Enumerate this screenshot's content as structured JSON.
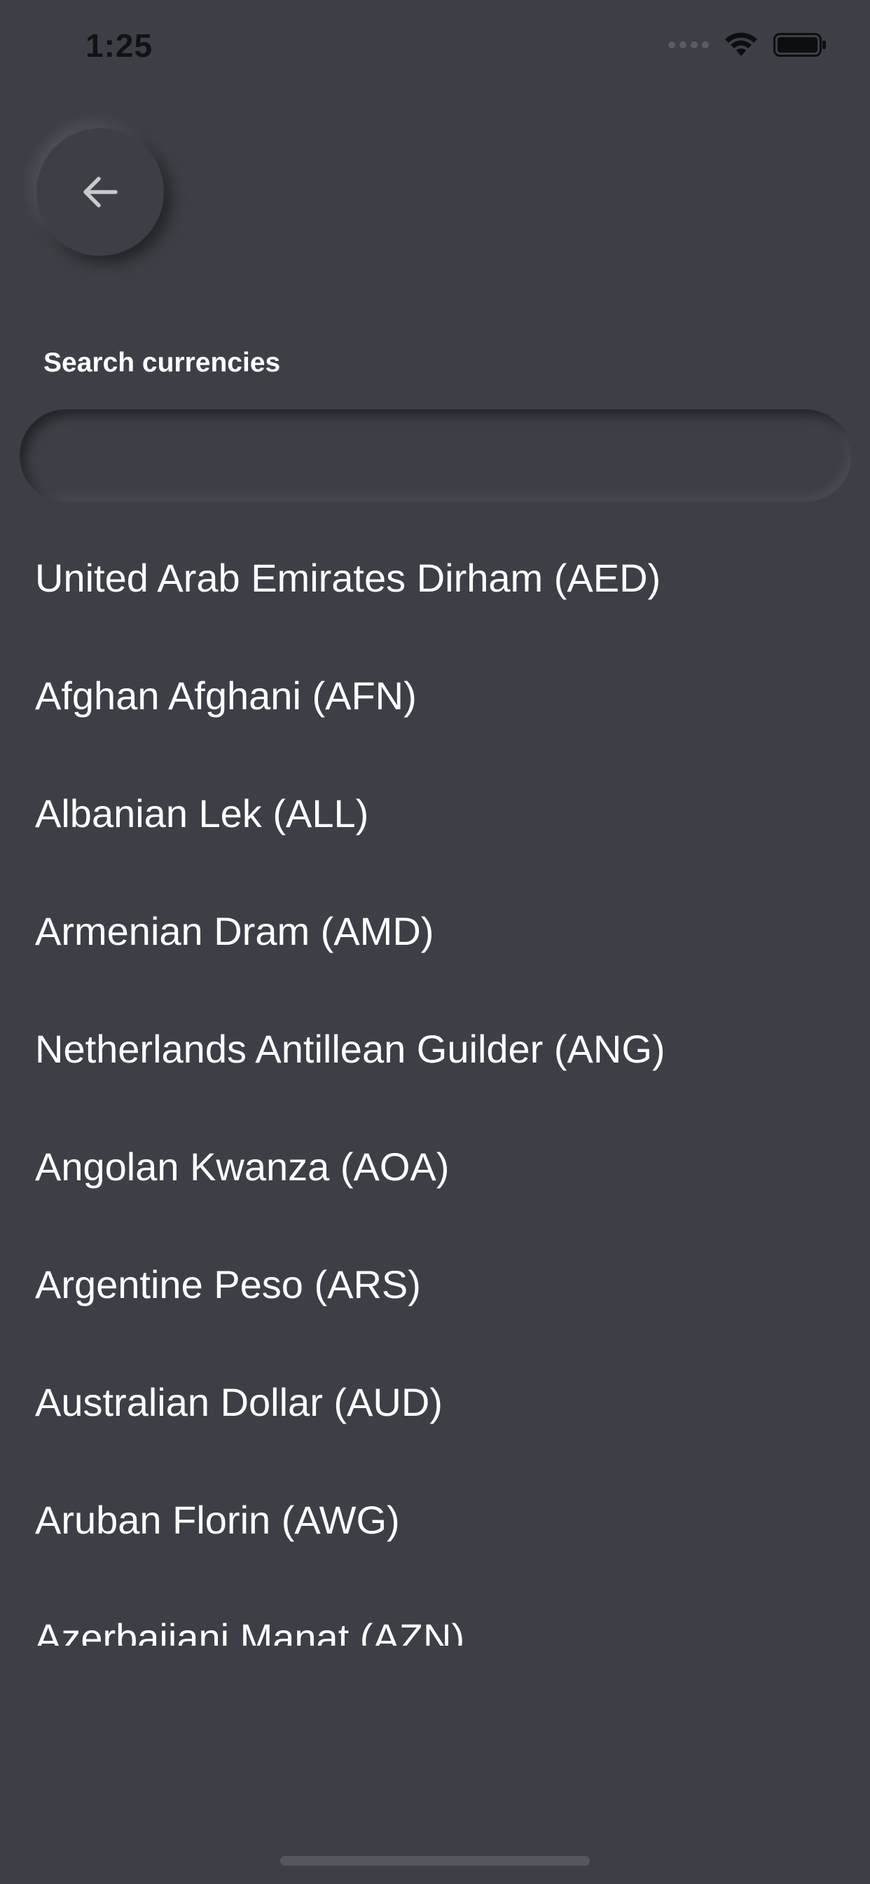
{
  "status_bar": {
    "time": "1:25"
  },
  "back_button": {
    "icon": "arrow-left-icon"
  },
  "search": {
    "label": "Search currencies",
    "value": "",
    "placeholder": ""
  },
  "currencies": [
    "United Arab Emirates Dirham (AED)",
    "Afghan Afghani (AFN)",
    "Albanian Lek (ALL)",
    "Armenian Dram (AMD)",
    "Netherlands Antillean Guilder (ANG)",
    "Angolan Kwanza (AOA)",
    "Argentine Peso (ARS)",
    "Australian Dollar (AUD)",
    "Aruban Florin (AWG)",
    "Azerbaijani Manat (AZN)"
  ],
  "colors": {
    "background": "#3d3f46",
    "text": "#ffffff",
    "status_text": "#111214"
  }
}
